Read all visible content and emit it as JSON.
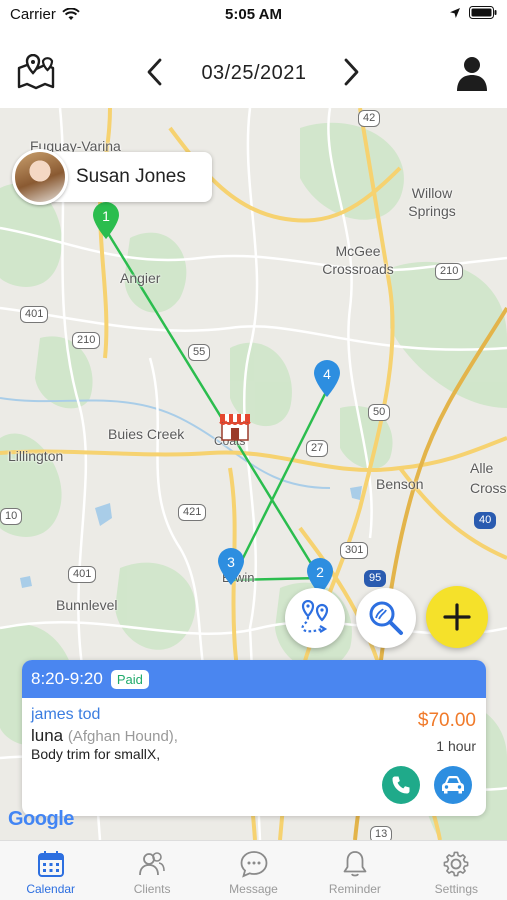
{
  "status_bar": {
    "carrier": "Carrier",
    "time": "5:05 AM"
  },
  "header": {
    "date": "03/25/2021"
  },
  "map": {
    "client_name": "Susan Jones",
    "place_labels": [
      "Fuquay-Varina",
      "Angier",
      "Willow Springs",
      "McGee Crossroads",
      "Buies Creek",
      "Lillington",
      "Coats",
      "Benson",
      "Erwin",
      "Bunnlevel",
      "Alle Cross"
    ],
    "road_shields": [
      "42",
      "401",
      "210",
      "55",
      "210",
      "50",
      "27",
      "421",
      "301",
      "401",
      "95",
      "40",
      "10",
      "13"
    ],
    "markers": [
      "1",
      "2",
      "3",
      "4"
    ],
    "attribution": "Google"
  },
  "appointment": {
    "time_range": "8:20-9:20",
    "status": "Paid",
    "client": "james tod",
    "pet": "luna",
    "breed": "(Afghan Hound),",
    "service": "Body trim for smallX,",
    "price": "$70.00",
    "duration": "1 hour"
  },
  "tabs": [
    {
      "label": "Calendar",
      "icon": "calendar-icon",
      "active": true
    },
    {
      "label": "Clients",
      "icon": "clients-icon",
      "active": false
    },
    {
      "label": "Message",
      "icon": "message-icon",
      "active": false
    },
    {
      "label": "Reminder",
      "icon": "bell-icon",
      "active": false
    },
    {
      "label": "Settings",
      "icon": "gear-icon",
      "active": false
    }
  ],
  "colors": {
    "accent": "#2d6fe0",
    "route": "#2bbd4e",
    "card_header": "#4a86f0",
    "price": "#f07a2a",
    "paid": "#1faa6b",
    "add_button": "#f5e12a"
  }
}
